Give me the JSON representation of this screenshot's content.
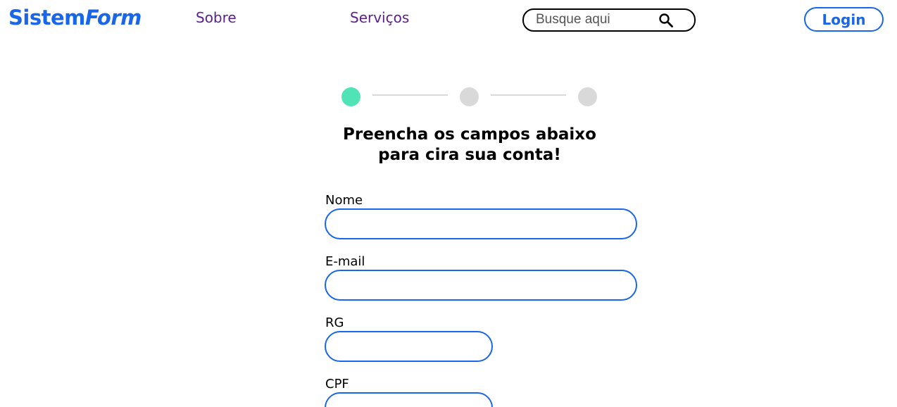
{
  "header": {
    "logo": {
      "part_a": "Sistem",
      "part_b": "Form"
    },
    "nav": [
      {
        "label": "Sobre"
      },
      {
        "label": "Serviços"
      }
    ],
    "search": {
      "placeholder": "Busque aqui",
      "value": "",
      "icon": "search-icon"
    },
    "login_label": "Login"
  },
  "stepper": {
    "steps": [
      {
        "status": "active",
        "color": "#4fe3b5"
      },
      {
        "status": "inactive",
        "color": "#d9d9d9"
      },
      {
        "status": "inactive",
        "color": "#d9d9d9"
      }
    ]
  },
  "form": {
    "heading_line1": "Preencha os campos abaixo",
    "heading_line2": "para cira sua conta!",
    "fields": [
      {
        "label": "Nome",
        "value": ""
      },
      {
        "label": "E-mail",
        "value": ""
      },
      {
        "label": "RG",
        "value": ""
      },
      {
        "label": "CPF",
        "value": ""
      }
    ]
  },
  "colors": {
    "brand_blue": "#1a66e8",
    "nav_purple": "#5b1f8e",
    "step_active": "#4fe3b5",
    "step_inactive": "#d9d9d9"
  }
}
